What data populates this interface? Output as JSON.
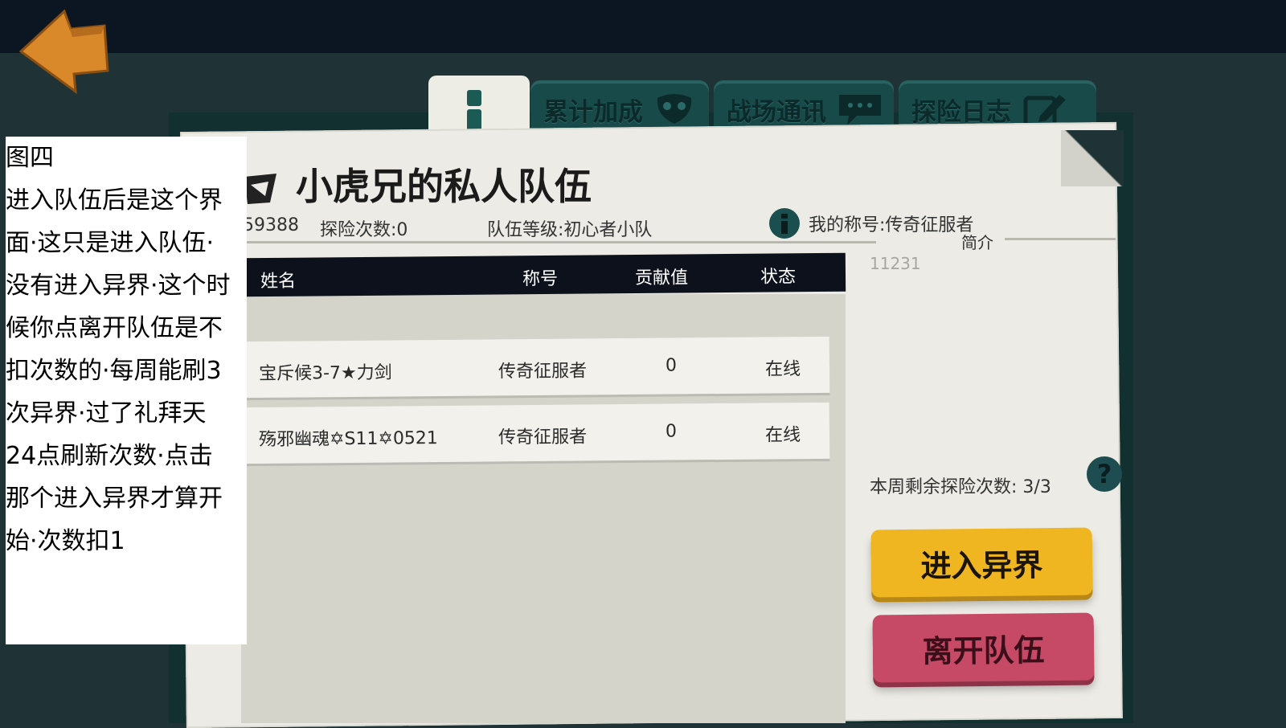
{
  "tabs": [
    {
      "label": "累计加成",
      "icon": "mask-icon"
    },
    {
      "label": "战场通讯",
      "icon": "chat-icon"
    },
    {
      "label": "探险日志",
      "icon": "edit-icon"
    }
  ],
  "team": {
    "name": "小虎兄的私人队伍",
    "id_fragment": "59388",
    "adventure_count": "探险次数:0",
    "team_level": "队伍等级:初心者小队",
    "my_title": "我的称号:传奇征服者",
    "intro_label": "简介",
    "intro_text": "11231"
  },
  "table": {
    "headers": [
      "姓名",
      "称号",
      "贡献值",
      "状态"
    ],
    "rows": [
      {
        "name": "宝斥候3-7★力剑",
        "title": "传奇征服者",
        "contribution": "0",
        "status": "在线"
      },
      {
        "name": "殇邪幽魂✡S11✡0521",
        "title": "传奇征服者",
        "contribution": "0",
        "status": "在线"
      }
    ]
  },
  "weekly_remaining": "本周剩余探险次数:  3/3",
  "buttons": {
    "enter": "进入异界",
    "leave": "离开队伍"
  },
  "note": {
    "lines": [
      "图四",
      "进入队伍后是这个界",
      "面·这只是进入队伍·",
      "没有进入异界·这个时",
      "候你点离开队伍是不",
      "扣次数的·每周能刷3",
      "次异界·过了礼拜天",
      "24点刷新次数·点击",
      "那个进入异界才算开",
      "始·次数扣1"
    ]
  },
  "colors": {
    "accent_yellow": "#f0b622",
    "accent_red": "#c64a66",
    "tab_teal": "#194a4a"
  }
}
